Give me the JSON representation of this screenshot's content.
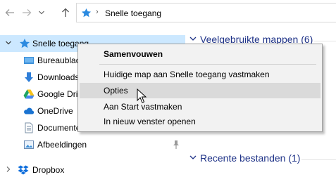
{
  "address_bar": {
    "back_icon": "back-arrow-icon",
    "forward_icon": "forward-arrow-icon",
    "recent_icon": "chevron-down-icon",
    "up_icon": "up-arrow-icon",
    "location_icon": "star-icon",
    "path": "Snelle toegang"
  },
  "nav_pane": {
    "items": [
      {
        "label": "Snelle toegang",
        "icon": "star-icon",
        "selected": true,
        "expanded": true
      },
      {
        "label": "Bureaublad",
        "icon": "desktop-icon"
      },
      {
        "label": "Downloads",
        "icon": "download-icon"
      },
      {
        "label": "Google Drive",
        "icon": "google-drive-icon"
      },
      {
        "label": "OneDrive",
        "icon": "onedrive-cloud-icon"
      },
      {
        "label": "Documenten",
        "icon": "document-icon"
      },
      {
        "label": "Afbeeldingen",
        "icon": "pictures-icon",
        "pinned": true
      },
      {
        "label": "Dropbox",
        "icon": "dropbox-icon",
        "expandable": true
      }
    ]
  },
  "content": {
    "groups": [
      {
        "title": "Veelgebruikte mappen (6)"
      },
      {
        "title": "Recente bestanden (1)"
      }
    ]
  },
  "context_menu": {
    "items": [
      {
        "label": "Samenvouwen",
        "bold": true
      },
      {
        "label": "Huidige map aan Snelle toegang vastmaken"
      },
      {
        "label": "Opties",
        "hover": true
      },
      {
        "label": "Aan Start vastmaken"
      },
      {
        "label": "In nieuw venster openen"
      }
    ]
  },
  "colors": {
    "selection": "#cce8ff",
    "group_header": "#1e3287",
    "menu_background": "#f2f2f2",
    "menu_hover": "#dadada"
  }
}
